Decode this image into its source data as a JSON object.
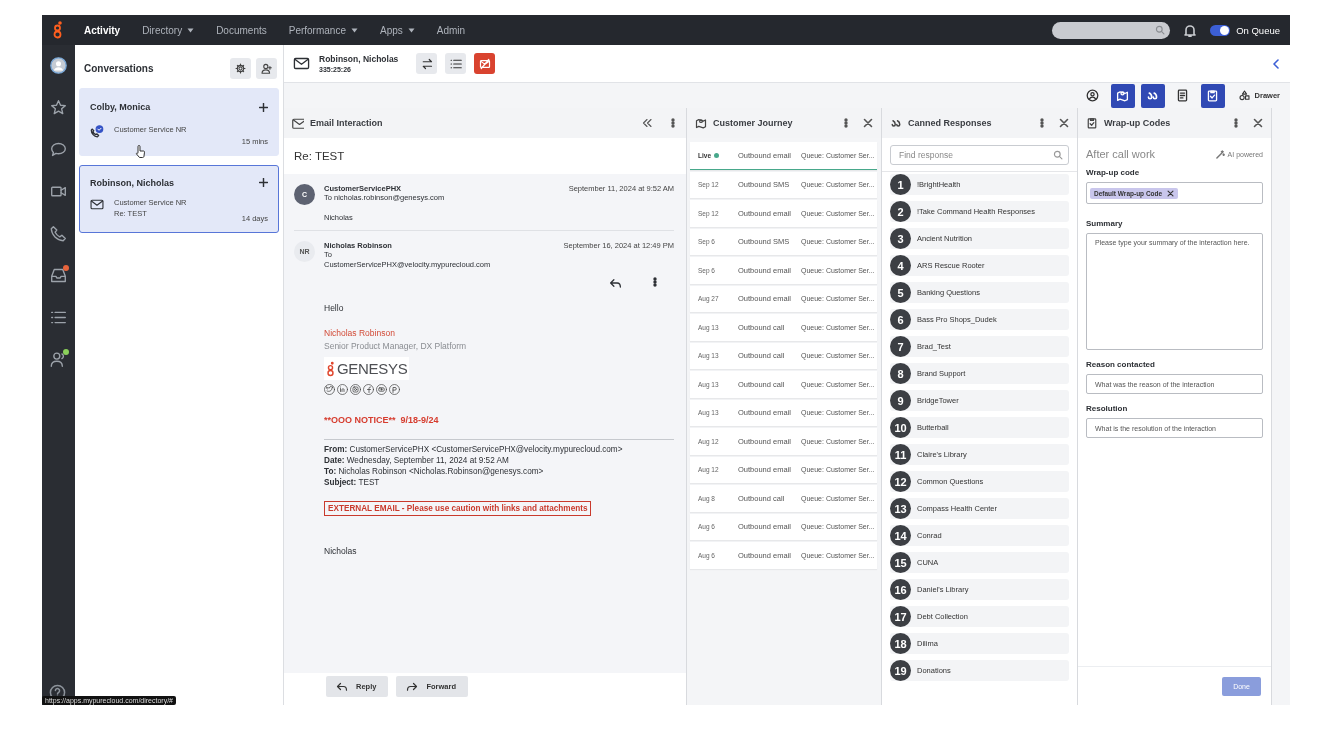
{
  "nav": {
    "items": [
      {
        "label": "Activity",
        "dropdown": false,
        "selected": true
      },
      {
        "label": "Directory",
        "dropdown": true,
        "selected": false
      },
      {
        "label": "Documents",
        "dropdown": false,
        "selected": false
      },
      {
        "label": "Performance",
        "dropdown": true,
        "selected": false
      },
      {
        "label": "Apps",
        "dropdown": true,
        "selected": false
      },
      {
        "label": "Admin",
        "dropdown": false,
        "selected": false
      }
    ],
    "queue_toggle": {
      "label": "On Queue",
      "on": true
    }
  },
  "rail": {
    "items": [
      {
        "kind": "avatar"
      },
      {
        "kind": "star"
      },
      {
        "kind": "chat"
      },
      {
        "kind": "video"
      },
      {
        "kind": "phone"
      },
      {
        "kind": "inbox",
        "color": "#e8643c"
      },
      {
        "kind": "list"
      },
      {
        "kind": "agents",
        "color": "#8bd15b"
      }
    ]
  },
  "conversations": {
    "title": "Conversations",
    "items": [
      {
        "name": "Colby, Monica",
        "kind": "call",
        "queue": "Customer Service NR",
        "time": "15 mins",
        "selected": false
      },
      {
        "name": "Robinson, Nicholas",
        "kind": "email",
        "queue": "Customer Service NR",
        "subject": "Re: TEST",
        "time": "14 days",
        "selected": true
      }
    ]
  },
  "interaction": {
    "name": "Robinson, Nicholas",
    "timer": "335:25:26"
  },
  "tool_tabs": [
    {
      "kind": "profile",
      "selected": false
    },
    {
      "kind": "journey",
      "selected": true
    },
    {
      "kind": "canned",
      "selected": true
    },
    {
      "kind": "notes",
      "selected": false
    },
    {
      "kind": "wrapup",
      "selected": true
    }
  ],
  "drawer": {
    "label": "Drawer"
  },
  "email": {
    "title": "Email Interaction",
    "subject": "Re: TEST",
    "messages": [
      {
        "initials": "C",
        "sender": "CustomerServicePHX",
        "to": "To nicholas.robinson@genesys.com",
        "date": "September 11, 2024 at 9:52 AM",
        "preview": "Nicholas",
        "expanded": false
      },
      {
        "initials": "NR",
        "sender": "Nicholas Robinson",
        "to": "To",
        "to_address": "CustomerServicePHX@velocity.mypurecloud.com",
        "date": "September 16, 2024 at 12:49 PM",
        "expanded": true,
        "body": {
          "greeting": "Hello",
          "sig_name": "Nicholas Robinson",
          "sig_title": "Senior Product Manager, DX Platform",
          "logo_text": "GENESYS",
          "notice": "**OOO NOTICE**  9/18-9/24",
          "quoted": [
            "**From:** CustomerServicePHX <CustomerServicePHX@velocity.mypurecloud.com>",
            "**Date:** Wednesday, September 11, 2024 at 9:52 AM",
            "**To:** Nicholas Robinson <Nicholas.Robinson@genesys.com>",
            "**Subject:** TEST"
          ],
          "warning": "EXTERNAL EMAIL - Please use caution with links and attachments",
          "closing": "Nicholas"
        }
      }
    ],
    "buttons": [
      {
        "kind": "reply",
        "label": "Reply"
      },
      {
        "kind": "forward",
        "label": "Forward"
      }
    ]
  },
  "journey": {
    "title": "Customer Journey",
    "rows": [
      {
        "date": "Live",
        "live": true,
        "channel": "Outbound email",
        "queue": "Queue: Customer Ser..."
      },
      {
        "date": "Sep 12",
        "live": false,
        "channel": "Outbound SMS",
        "queue": "Queue: Customer Ser..."
      },
      {
        "date": "Sep 12",
        "live": false,
        "channel": "Outbound email",
        "queue": "Queue: Customer Ser..."
      },
      {
        "date": "Sep 6",
        "live": false,
        "channel": "Outbound SMS",
        "queue": "Queue: Customer Ser..."
      },
      {
        "date": "Sep 6",
        "live": false,
        "channel": "Outbound email",
        "queue": "Queue: Customer Ser..."
      },
      {
        "date": "Aug 27",
        "live": false,
        "channel": "Outbound email",
        "queue": "Queue: Customer Ser..."
      },
      {
        "date": "Aug 13",
        "live": false,
        "channel": "Outbound call",
        "queue": "Queue: Customer Ser..."
      },
      {
        "date": "Aug 13",
        "live": false,
        "channel": "Outbound call",
        "queue": "Queue: Customer Ser..."
      },
      {
        "date": "Aug 13",
        "live": false,
        "channel": "Outbound call",
        "queue": "Queue: Customer Ser..."
      },
      {
        "date": "Aug 13",
        "live": false,
        "channel": "Outbound email",
        "queue": "Queue: Customer Ser..."
      },
      {
        "date": "Aug 12",
        "live": false,
        "channel": "Outbound email",
        "queue": "Queue: Customer Ser..."
      },
      {
        "date": "Aug 12",
        "live": false,
        "channel": "Outbound email",
        "queue": "Queue: Customer Ser..."
      },
      {
        "date": "Aug 8",
        "live": false,
        "channel": "Outbound call",
        "queue": "Queue: Customer Ser..."
      },
      {
        "date": "Aug 6",
        "live": false,
        "channel": "Outbound email",
        "queue": "Queue: Customer Ser..."
      },
      {
        "date": "Aug 6",
        "live": false,
        "channel": "Outbound email",
        "queue": "Queue: Customer Ser..."
      }
    ]
  },
  "canned": {
    "title": "Canned Responses",
    "search_placeholder": "Find response",
    "items": [
      {
        "number": "1",
        "label": "!BrightHealth"
      },
      {
        "number": "2",
        "label": "!Take Command Health Responses"
      },
      {
        "number": "3",
        "label": "Ancient Nutrition"
      },
      {
        "number": "4",
        "label": "ARS Rescue Rooter"
      },
      {
        "number": "5",
        "label": "Banking Questions"
      },
      {
        "number": "6",
        "label": "Bass Pro Shops_Dudek"
      },
      {
        "number": "7",
        "label": "Brad_Test"
      },
      {
        "number": "8",
        "label": "Brand Support"
      },
      {
        "number": "9",
        "label": "BridgeTower"
      },
      {
        "number": "10",
        "label": "Butterball"
      },
      {
        "number": "11",
        "label": "Claire's Library"
      },
      {
        "number": "12",
        "label": "Common Questions"
      },
      {
        "number": "13",
        "label": "Compass Health Center"
      },
      {
        "number": "14",
        "label": "Conrad"
      },
      {
        "number": "15",
        "label": "CUNA"
      },
      {
        "number": "16",
        "label": "Daniel's Library"
      },
      {
        "number": "17",
        "label": "Debt Collection"
      },
      {
        "number": "18",
        "label": "Dilima"
      },
      {
        "number": "19",
        "label": "Donations"
      }
    ]
  },
  "wrapup": {
    "title": "Wrap-up Codes",
    "heading": "After call work",
    "ai_label": "AI powered",
    "code_label": "Wrap-up code",
    "code_chip": "Default Wrap-up Code",
    "summary_label": "Summary",
    "summary_placeholder": "Please type your summary of the interaction here.",
    "reason_label": "Reason contacted",
    "reason_placeholder": "What was the reason of the interaction",
    "resolution_label": "Resolution",
    "resolution_placeholder": "What is the resolution of the interaction",
    "done": {
      "label": "Done",
      "disabled": true
    }
  },
  "status_url": "https://apps.mypurecloud.com/directory/#"
}
